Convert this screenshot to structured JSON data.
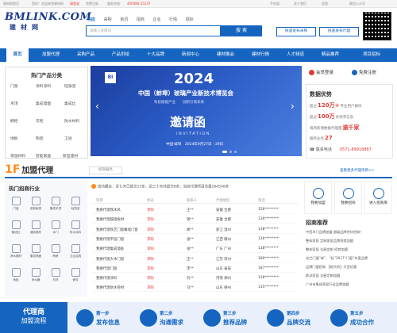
{
  "topbar": {
    "welcome": "建材网首页",
    "tip": "您好！欢迎来到建材网",
    "login": "请登录",
    "register": "免费注册",
    "hotline_label": "服务热线：",
    "hotline": "400086-15137",
    "links": [
      "手机版",
      "关于我们",
      "导航",
      "微信公众号"
    ]
  },
  "logo": {
    "main": "BMLINK.COM",
    "sub": "建材网"
  },
  "search": {
    "tabs": [
      "供应",
      "采购",
      "资讯",
      "招商",
      "企业",
      "行情",
      "招标"
    ],
    "placeholder": "请输入关键词",
    "button": "搜 索",
    "publish_buy": "快速发布采购",
    "publish_agent": "快速发布代理"
  },
  "nav": [
    "首页",
    "加盟代理",
    "采购产品",
    "产品供给",
    "十大品牌",
    "新闻中心",
    "建材展会",
    "建材行情",
    "人才频道",
    "精品推荐",
    "项目招标"
  ],
  "hot_products": {
    "title": "热门产品分类",
    "items": [
      "门窗",
      "涂料涂料",
      "硅藻泥",
      "吊顶",
      "集成墙面",
      "集成灶",
      "橱柜",
      "衣柜",
      "防水材料",
      "地板",
      "陶瓷",
      "卫浴",
      "保温材料",
      "智能家居",
      "新型建材"
    ]
  },
  "banner": {
    "logo_text": "BI",
    "year": "2024",
    "title": "中国（蚌埠）玻璃产业新技术博览会",
    "tagline": "科技赋能产业　　创新引领未来",
    "headline": "邀请函",
    "sub": "INVITATION",
    "date": "中国·蚌埠　2024年9月27日 - 29日"
  },
  "account": {
    "login": "会员登录",
    "register": "免费注册"
  },
  "stats": {
    "title": "数据优势",
    "r1_pre": "超过",
    "r1_val": "120万+",
    "r1_post": "专业用户群体",
    "r2_pre": "超过",
    "r2_val": "100万",
    "r2_post": "条供求信息",
    "r3_pre": "每周新增数据代理量",
    "r3_val": "逾千家",
    "r4_pre": "服务业务",
    "r4_val": "27",
    "phone_label": "联系电话",
    "phone": "0571-89918887"
  },
  "section": {
    "num": "1F",
    "title": "加盟代理",
    "tab": "招商服务",
    "more": "查看更多代理项目>>"
  },
  "industries": {
    "title": "热门招商行业",
    "items": [
      "门窗",
      "定制家具",
      "集成吊顶",
      "硅藻泥",
      "集成灶",
      "墙纸墙布",
      "木门",
      "防水涂料",
      "净水器材",
      "集成墙面",
      "陶瓷",
      "卫浴洁具",
      "地板",
      "净水器",
      "石材",
      "瓷砖"
    ]
  },
  "table": {
    "success": "成功撮合：近七天已提交15条，近三十天共提交8条，当前代理项目总量264508条",
    "headers": [
      "项目",
      "状态",
      "联系人",
      "代理地区",
      "电话"
    ],
    "rows": [
      [
        "我要代理铁木风",
        "求购",
        "王**",
        "安徽 合肥",
        "156********"
      ],
      [
        "我要代理隔墙板材",
        "求购",
        "钱**",
        "安徽 合肥",
        "136********"
      ],
      [
        "我要代理铁艺门窗幕墙门窗",
        "求购",
        "郑**",
        "浙江 温州",
        "138********"
      ],
      [
        "我要代理平层门窗",
        "求购",
        "张**",
        "江西 赣州",
        "136********"
      ],
      [
        "我要代理集成墙板",
        "求购",
        "张**",
        "广东 广州",
        "138********"
      ],
      [
        "我要代理大木门窗",
        "求购",
        "王**",
        "江苏 常州",
        "189********"
      ],
      [
        "我要代理门窗",
        "求购",
        "李**",
        "山东 泰安",
        "187********"
      ],
      [
        "我要代理涂料",
        "求购",
        "刘**",
        "河南 郑州",
        "138********"
      ],
      [
        "我要代理防水卷材",
        "求购",
        "马**",
        "山东 德州",
        "135********"
      ]
    ]
  },
  "quick": [
    "我要加盟",
    "我要招商",
    "进入招商库"
  ],
  "recommend": {
    "title": "招商推荐",
    "items": [
      "中西木门品牌加盟 超级品牌合伙招商！",
      "整体家居 定制家居品牌招商加盟",
      "整体家居 全屋定制 招商加盟",
      "米兰门窗“新”、“标”2017“门窗”年度品牌",
      "品牌门窗招商 【跨大的】大型优惠",
      "欧派家居 全屋定制加盟",
      "广州市集成家居行业品牌加盟"
    ]
  },
  "steps": {
    "proxy_a": "代理商",
    "proxy_b": "加盟流程",
    "items": [
      {
        "n": "第一步",
        "t": "发布信息"
      },
      {
        "n": "第二步",
        "t": "沟通需求"
      },
      {
        "n": "第三步",
        "t": "推荐品牌"
      },
      {
        "n": "第四步",
        "t": "品牌交流"
      },
      {
        "n": "第五步",
        "t": "成功合作"
      }
    ]
  },
  "colors": {
    "primary": "#1565c0",
    "accent": "#ff8c1a",
    "alert": "#e53935"
  }
}
